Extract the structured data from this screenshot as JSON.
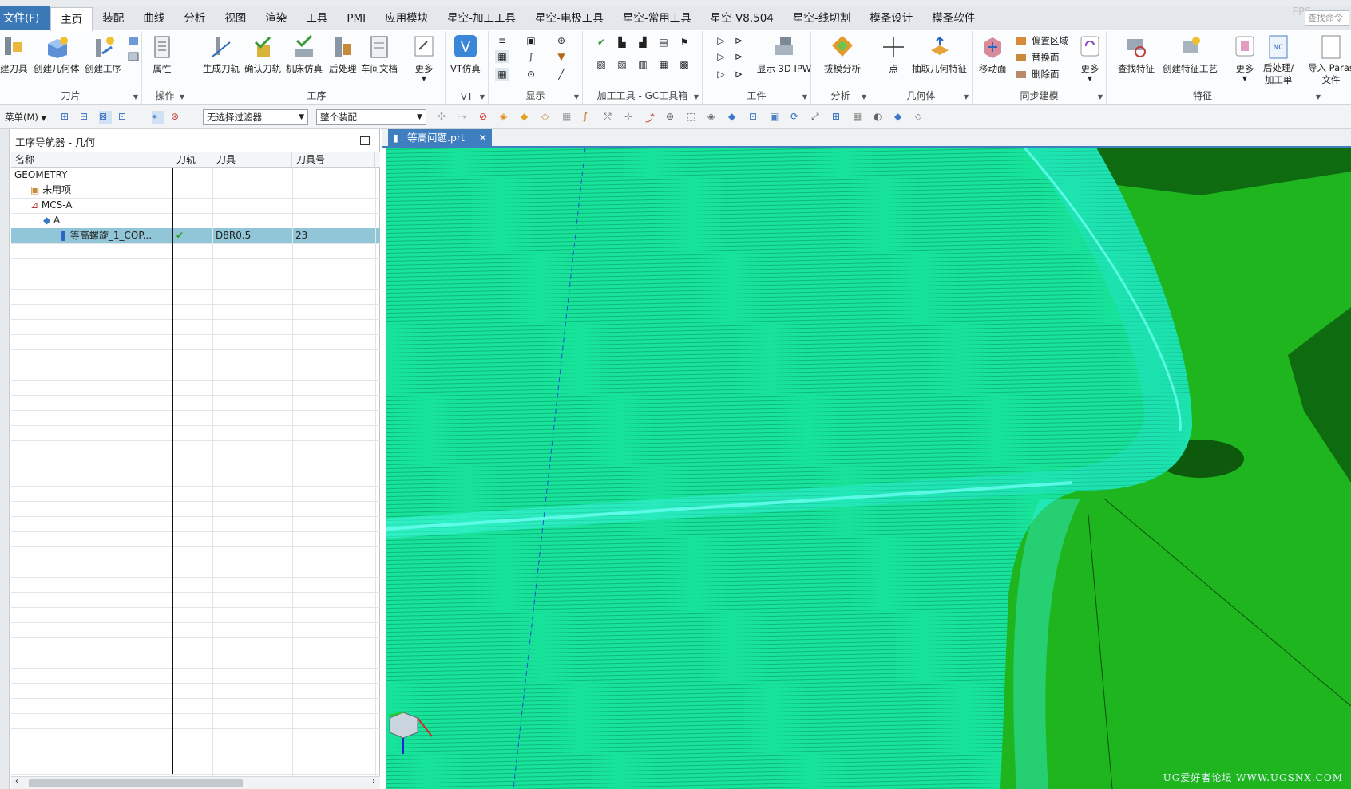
{
  "menu": {
    "file": "文件(F)",
    "tabs": [
      "主页",
      "装配",
      "曲线",
      "分析",
      "视图",
      "渲染",
      "工具",
      "PMI",
      "应用模块",
      "星空-加工工具",
      "星空-电极工具",
      "星空-常用工具",
      "星空 V8.504",
      "星空-线切割",
      "模圣设计",
      "模圣软件"
    ],
    "active": "主页",
    "fps": "FPS",
    "search_placeholder": "查找命令"
  },
  "ribbon": {
    "groups": {
      "blade": "刀片",
      "operate": "操作",
      "process": "工序",
      "vt": "VT",
      "display": "显示",
      "gc": "加工工具 - GC工具箱",
      "workpiece": "工件",
      "analysis": "分析",
      "geometry": "几何体",
      "sync": "同步建模",
      "feature": "特征"
    },
    "buttons": {
      "create_tool": "建刀具",
      "create_geometry": "创建几何体",
      "create_operation": "创建工序",
      "attribute": "属性",
      "generate_path": "生成刀轨",
      "verify_path": "确认刀轨",
      "machine_sim": "机床仿真",
      "postprocess": "后处理",
      "shop_doc": "车间文档",
      "more1": "更多",
      "vt_sim": "VT仿真",
      "show_ipw": "显示 3D IPW",
      "draft_analysis": "拔模分析",
      "point": "点",
      "extract_geometry": "抽取几何特征",
      "move_face": "移动面",
      "offset_region": "偏置区域",
      "replace_face": "替换面",
      "delete_face": "删除面",
      "more2": "更多",
      "find_feature": "查找特征",
      "create_feature_process": "创建特征工艺",
      "more3": "更多",
      "post_process_sheet": "后处理/\n加工单",
      "import_parasolid": "导入 Paras\n文件"
    }
  },
  "toolbar": {
    "menu_label": "菜单(M)",
    "filter": "无选择过滤器",
    "assembly_scope": "整个装配"
  },
  "navigator": {
    "title": "工序导航器 - 几何",
    "columns": [
      "名称",
      "刀轨",
      "刀具",
      "刀具号"
    ],
    "rows": [
      {
        "name": "GEOMETRY",
        "path": "",
        "tool": "",
        "toolno": ""
      },
      {
        "name": "未用项",
        "path": "",
        "tool": "",
        "toolno": ""
      },
      {
        "name": "MCS-A",
        "path": "",
        "tool": "",
        "toolno": ""
      },
      {
        "name": "A",
        "path": "",
        "tool": "",
        "toolno": ""
      },
      {
        "name": "等高螺旋_1_COP...",
        "path": "✔",
        "tool": "D8R0.5",
        "toolno": "23"
      }
    ]
  },
  "viewport": {
    "tab_title": "等高问题.prt",
    "watermark": "UG爱好者论坛 WWW.UGSNX.COM"
  },
  "colors": {
    "accent": "#3f7fc0",
    "selected_row": "#91c5d8",
    "model_green": "#1aa81a",
    "toolpath_cyan": "#3affea"
  }
}
